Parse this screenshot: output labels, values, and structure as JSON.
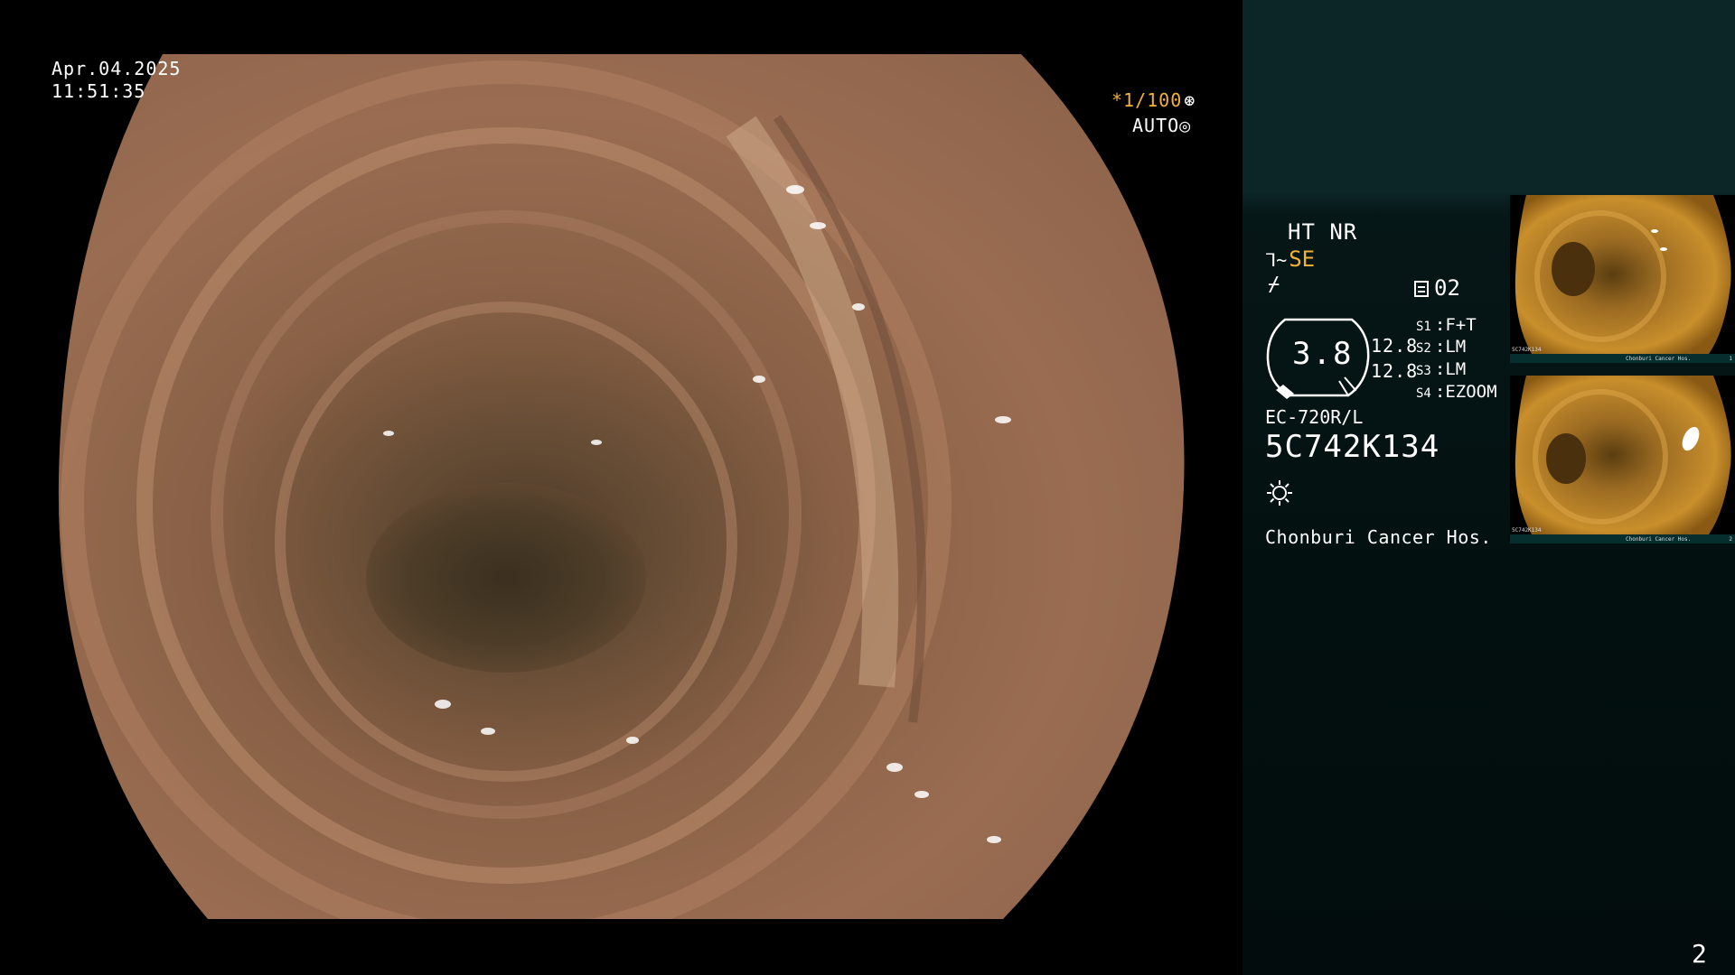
{
  "osd": {
    "date": "Apr.04.2025",
    "time": "11:51:35",
    "shutter": "*1/100",
    "shutter_icon": "aperture-icon",
    "auto": "AUTO",
    "auto_icon": "iris-icon"
  },
  "panel": {
    "ht_nr": "HT NR",
    "se_label": "SE",
    "memo_count": "02",
    "zoom_value": "3.8",
    "zoom_a": "12.8",
    "zoom_b": "12.8",
    "s_settings": [
      {
        "key": "S1",
        "value": "F+T"
      },
      {
        "key": "S2",
        "value": "LM"
      },
      {
        "key": "S3",
        "value": "LM"
      },
      {
        "key": "S4",
        "value": "EZOOM"
      }
    ],
    "scope_model": "EC-720R/L",
    "scope_serial": "5C742K134",
    "hospital": "Chonburi Cancer Hos."
  },
  "thumbnails": [
    {
      "serial": "5C742K134",
      "hospital": "Chonburi Cancer Hos.",
      "index": "1"
    },
    {
      "serial": "5C742K134",
      "hospital": "Chonburi Cancer Hos.",
      "index": "2"
    }
  ],
  "page_number": "2",
  "colors": {
    "accent": "#f2b23a",
    "panel_bg": "#0c2627",
    "panel_dark": "#031010"
  }
}
